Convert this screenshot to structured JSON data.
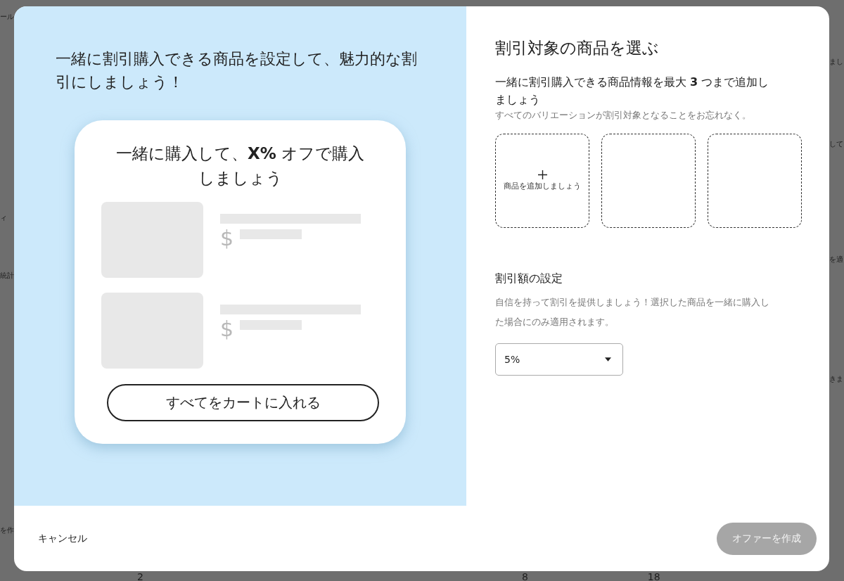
{
  "background": {
    "left_fragments": [
      "ール",
      "ィ",
      "統計",
      "を作"
    ],
    "right_fragments": [
      "まし",
      "して",
      "を適",
      "きま"
    ],
    "bottom_fragments": [
      "2",
      "8",
      "18"
    ]
  },
  "preview": {
    "headline": "一緒に割引購入できる商品を設定して、魅力的な割引にしましょう！",
    "card_title": "一緒に購入して、**X%** オフで購入しましょう",
    "products": [
      {
        "currency": "$"
      },
      {
        "currency": "$"
      }
    ],
    "cart_button": "すべてをカートに入れる"
  },
  "panel": {
    "title": "割引対象の商品を選ぶ",
    "products_heading": "一緒に割引購入できる商品情報を最大 **3** つまで追加しましょう",
    "products_hint": "すべてのバリエーションが割引対象となることをお忘れなく。",
    "slots": [
      {
        "kind": "add",
        "label": "商品を追加しましょう"
      },
      {
        "kind": "empty"
      },
      {
        "kind": "empty"
      }
    ],
    "discount_heading": "割引額の設定",
    "discount_description": "自信を持って割引を提供しましょう！選択した商品を一緒に購入した場合にのみ適用されます。",
    "discount_select": {
      "value": "5%"
    }
  },
  "footer": {
    "cancel": "キャンセル",
    "submit": {
      "label": "オファーを作成",
      "disabled": true
    }
  }
}
